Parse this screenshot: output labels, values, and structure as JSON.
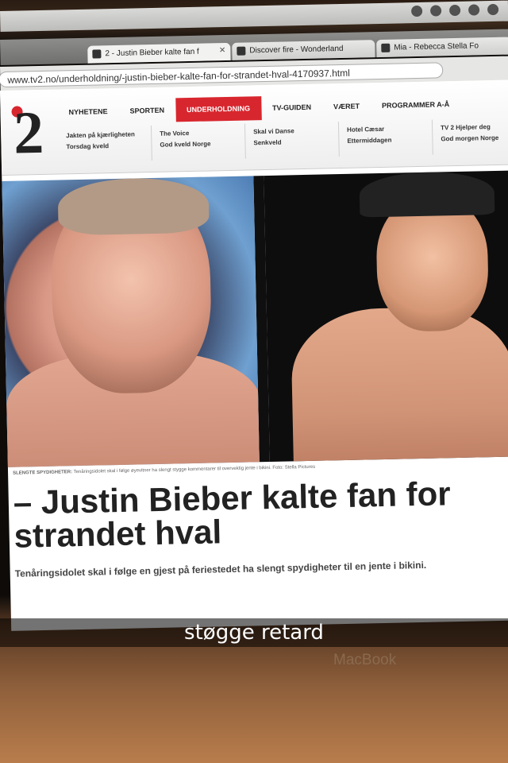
{
  "browser": {
    "tabs": [
      {
        "label": "2 - Justin Bieber kalte fan f"
      },
      {
        "label": "Discover fire - Wonderland"
      },
      {
        "label": "Mia - Rebecca Stella Fo"
      }
    ],
    "url": "www.tv2.no/underholdning/-justin-bieber-kalte-fan-for-strandet-hval-4170937.html"
  },
  "site": {
    "logo_text": "2",
    "main_nav": [
      "NYHETENE",
      "SPORTEN",
      "UNDERHOLDNING",
      "TV-GUIDEN",
      "VÆRET",
      "PROGRAMMER A-Å"
    ],
    "active_nav": "UNDERHOLDNING",
    "sub_nav": [
      [
        "Jakten på kjærligheten",
        "Torsdag kveld"
      ],
      [
        "The Voice",
        "God kveld Norge"
      ],
      [
        "Skal vi Danse",
        "Senkveld"
      ],
      [
        "Hotel Cæsar",
        "Ettermiddagen"
      ],
      [
        "TV 2 Hjelper deg",
        "God morgen Norge"
      ]
    ]
  },
  "article": {
    "photo_caption_label": "SLENGTE SPYDIGHETER:",
    "photo_caption": "Tenåringsidolet skal i følge øyevitner ha slengt stygge kommentarer til overvektig jente i bikini. Foto: Stella Pictures",
    "headline": "– Justin Bieber kalte fan for strandet hval",
    "lead": "Tenåringsidolet skal i følge en gjest på feriestedet ha slengt spydigheter til en jente i bikini."
  },
  "overlay": {
    "snap_caption": "støgge retard",
    "laptop_brand": "MacBook"
  },
  "colors": {
    "accent_red": "#d8262e"
  }
}
